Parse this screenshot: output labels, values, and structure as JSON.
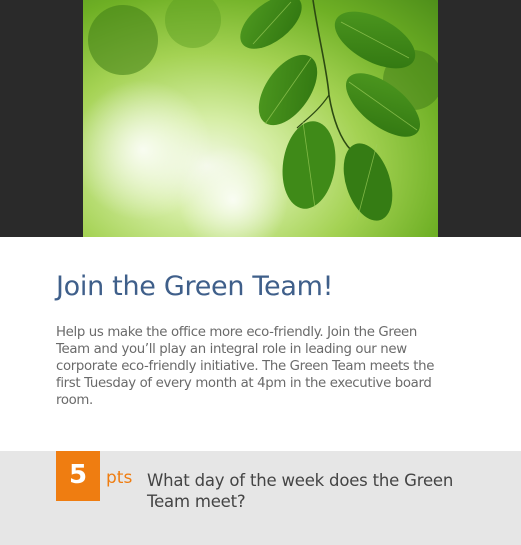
{
  "hero": {
    "image": "green-leaves-photo"
  },
  "content": {
    "title": "Join the Green Team!",
    "body": "Help us make the office more eco-friendly. Join the Green Team and you’ll play an integral role in leading our new corporate eco-friendly initiative. The Green Team meets the first Tuesday of every month at 4pm in the executive board room."
  },
  "question": {
    "points": "5",
    "points_unit": "pts",
    "text": "What day of the week does the Green Team meet?"
  },
  "colors": {
    "title": "#3f5f8a",
    "accent": "#ef7d11",
    "band": "#e6e6e6",
    "hero_bg": "#2a2a2a"
  }
}
